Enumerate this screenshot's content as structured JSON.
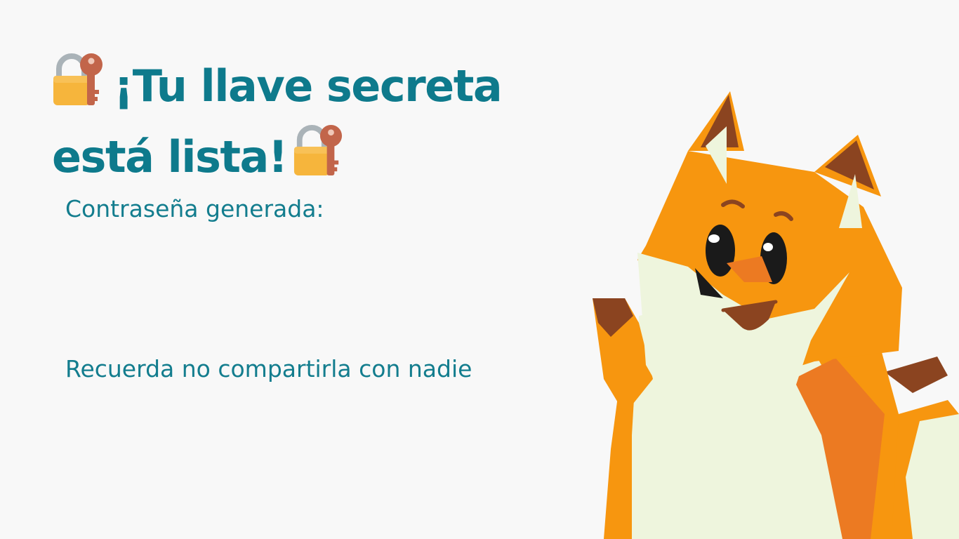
{
  "headline": {
    "line1": "¡Tu llave secreta",
    "line2": "está lista!",
    "icon": "lock-with-key-icon"
  },
  "password": {
    "label": "Contraseña generada:",
    "value": ""
  },
  "reminder": "Recuerda no compartirla con nadie",
  "mascot": "fox-mascot",
  "colors": {
    "background": "#f8f8f8",
    "text": "#0e7a8c",
    "fox_orange": "#f7960f",
    "fox_dark": "#8b4420",
    "fox_cream": "#eef5dd"
  }
}
